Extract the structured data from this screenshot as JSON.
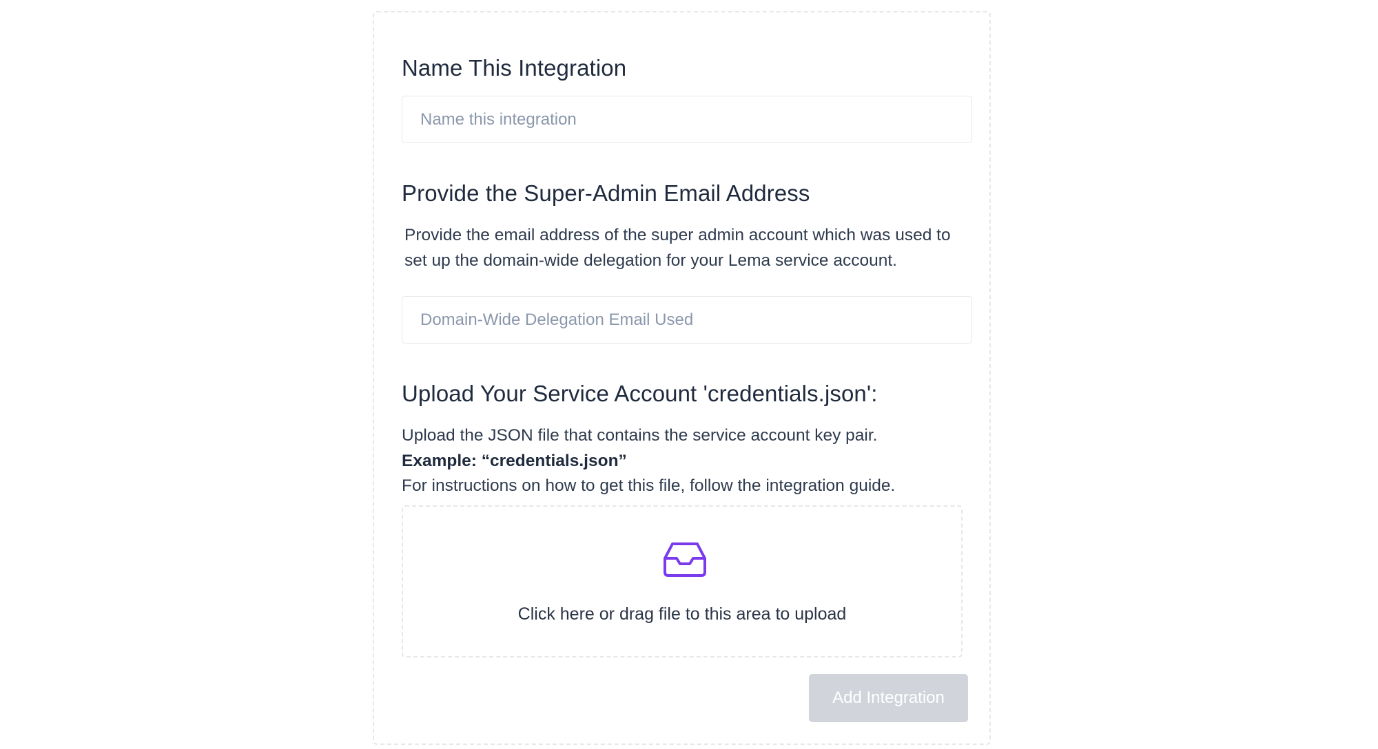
{
  "name_section": {
    "title": "Name This Integration",
    "input_placeholder": "Name this integration",
    "input_value": ""
  },
  "email_section": {
    "title": "Provide the Super-Admin Email Address",
    "description_line1": "Provide the email address of the super admin account which was used to",
    "description_line2": "set up the domain-wide delegation for your Lema service account.",
    "input_placeholder": "Domain-Wide Delegation Email Used",
    "input_value": ""
  },
  "upload_section": {
    "title": "Upload Your Service Account 'credentials.json':",
    "description_line1": "Upload the JSON file that contains the service account key pair.",
    "example_text": "Example: “credentials.json”",
    "description_line3": "For instructions on how to get this file, follow the integration guide.",
    "dropzone_icon": "inbox-icon",
    "dropzone_text": "Click here or drag file to this area to upload"
  },
  "actions": {
    "add_button_label": "Add Integration",
    "add_button_disabled": true
  },
  "colors": {
    "accent_icon": "#7c3aed",
    "disabled_button_bg": "#d1d5db",
    "border": "#e5e7eb",
    "placeholder": "#8a97ab"
  }
}
